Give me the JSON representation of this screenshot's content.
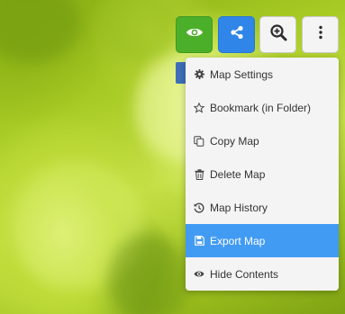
{
  "toolbar": {
    "buttons": [
      {
        "name": "eye-button",
        "icon": "eye-icon",
        "color": "#4caf2a"
      },
      {
        "name": "share-button",
        "icon": "share-icon",
        "color": "#2f86e8"
      },
      {
        "name": "zoom-button",
        "icon": "zoom-in-icon",
        "color": "#f4f4f4"
      },
      {
        "name": "more-button",
        "icon": "kebab-menu-icon",
        "color": "#f4f4f4"
      }
    ]
  },
  "menu": {
    "items": [
      {
        "label": "Map Settings",
        "icon": "gear-icon"
      },
      {
        "label": "Bookmark (in Folder)",
        "icon": "star-icon"
      },
      {
        "label": "Copy Map",
        "icon": "copy-icon"
      },
      {
        "label": "Delete Map",
        "icon": "trash-icon"
      },
      {
        "label": "Map History",
        "icon": "history-icon"
      },
      {
        "label": "Export Map",
        "icon": "save-icon",
        "highlighted": true
      },
      {
        "label": "Hide Contents",
        "icon": "eye-icon"
      }
    ],
    "highlight_color": "#429bf3"
  }
}
